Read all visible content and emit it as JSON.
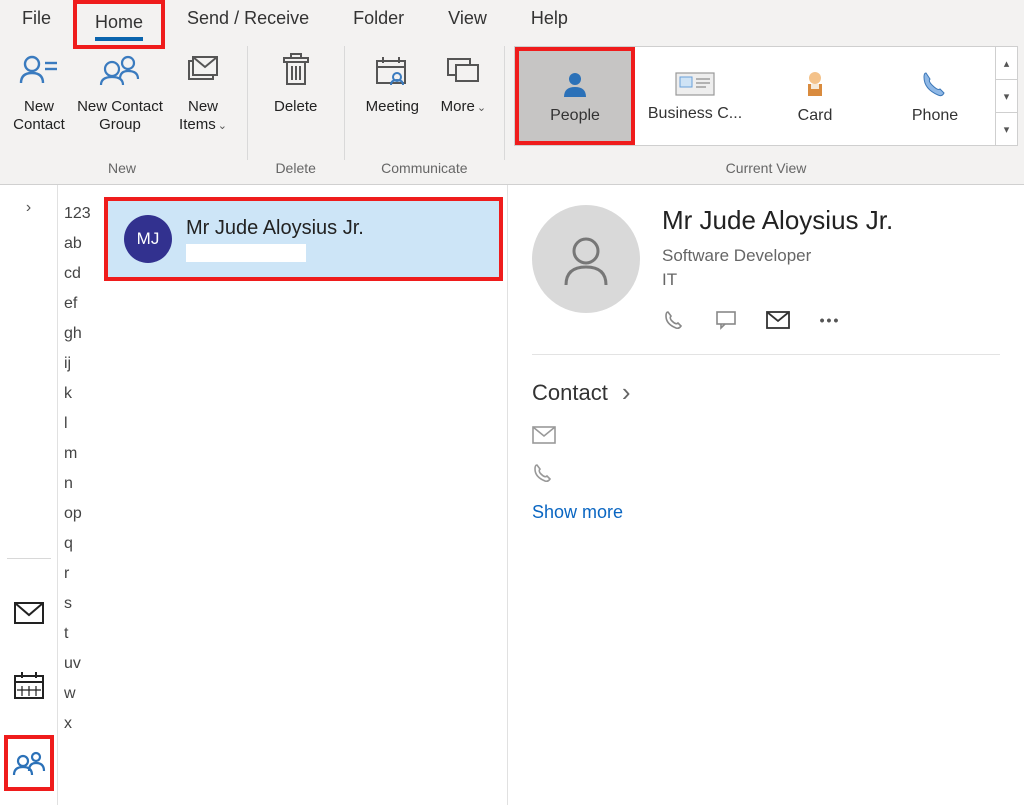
{
  "menu": {
    "items": [
      "File",
      "Home",
      "Send / Receive",
      "Folder",
      "View",
      "Help"
    ],
    "active_index": 1
  },
  "ribbon": {
    "new": {
      "label": "New",
      "new_contact": "New Contact",
      "new_contact_group": "New Contact Group",
      "new_items": "New Items"
    },
    "delete": {
      "label": "Delete",
      "button": "Delete"
    },
    "communicate": {
      "label": "Communicate",
      "meeting": "Meeting",
      "more": "More"
    },
    "current_view": {
      "label": "Current View",
      "items": [
        "People",
        "Business C...",
        "Card",
        "Phone"
      ],
      "selected_index": 0
    }
  },
  "alpha_index": [
    "123",
    "ab",
    "cd",
    "ef",
    "gh",
    "ij",
    "k",
    "l",
    "m",
    "n",
    "op",
    "q",
    "r",
    "s",
    "t",
    "uv",
    "w",
    "x"
  ],
  "contacts": [
    {
      "initials": "MJ",
      "name": "Mr Jude Aloysius Jr."
    }
  ],
  "detail": {
    "name": "Mr Jude Aloysius Jr.",
    "title": "Software Developer",
    "dept": "IT",
    "section": "Contact",
    "show_more": "Show more"
  },
  "icons": {
    "chevron_right": "›",
    "chevron_down": "⌄",
    "ellipsis": "•••"
  }
}
